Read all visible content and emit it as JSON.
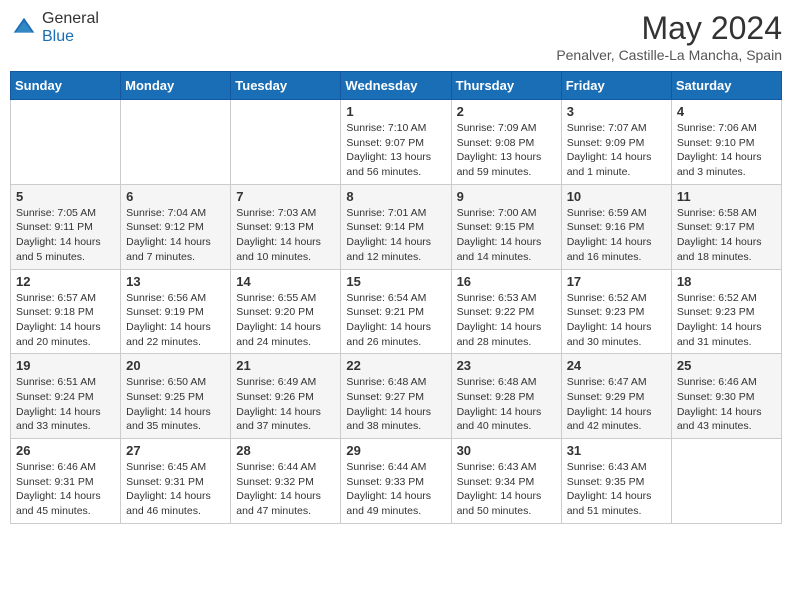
{
  "header": {
    "logo_general": "General",
    "logo_blue": "Blue",
    "month": "May 2024",
    "location": "Penalver, Castille-La Mancha, Spain"
  },
  "weekdays": [
    "Sunday",
    "Monday",
    "Tuesday",
    "Wednesday",
    "Thursday",
    "Friday",
    "Saturday"
  ],
  "weeks": [
    {
      "row_style": "odd",
      "days": [
        {
          "num": "",
          "info": ""
        },
        {
          "num": "",
          "info": ""
        },
        {
          "num": "",
          "info": ""
        },
        {
          "num": "1",
          "info": "Sunrise: 7:10 AM\nSunset: 9:07 PM\nDaylight: 13 hours\nand 56 minutes."
        },
        {
          "num": "2",
          "info": "Sunrise: 7:09 AM\nSunset: 9:08 PM\nDaylight: 13 hours\nand 59 minutes."
        },
        {
          "num": "3",
          "info": "Sunrise: 7:07 AM\nSunset: 9:09 PM\nDaylight: 14 hours\nand 1 minute."
        },
        {
          "num": "4",
          "info": "Sunrise: 7:06 AM\nSunset: 9:10 PM\nDaylight: 14 hours\nand 3 minutes."
        }
      ]
    },
    {
      "row_style": "even",
      "days": [
        {
          "num": "5",
          "info": "Sunrise: 7:05 AM\nSunset: 9:11 PM\nDaylight: 14 hours\nand 5 minutes."
        },
        {
          "num": "6",
          "info": "Sunrise: 7:04 AM\nSunset: 9:12 PM\nDaylight: 14 hours\nand 7 minutes."
        },
        {
          "num": "7",
          "info": "Sunrise: 7:03 AM\nSunset: 9:13 PM\nDaylight: 14 hours\nand 10 minutes."
        },
        {
          "num": "8",
          "info": "Sunrise: 7:01 AM\nSunset: 9:14 PM\nDaylight: 14 hours\nand 12 minutes."
        },
        {
          "num": "9",
          "info": "Sunrise: 7:00 AM\nSunset: 9:15 PM\nDaylight: 14 hours\nand 14 minutes."
        },
        {
          "num": "10",
          "info": "Sunrise: 6:59 AM\nSunset: 9:16 PM\nDaylight: 14 hours\nand 16 minutes."
        },
        {
          "num": "11",
          "info": "Sunrise: 6:58 AM\nSunset: 9:17 PM\nDaylight: 14 hours\nand 18 minutes."
        }
      ]
    },
    {
      "row_style": "odd",
      "days": [
        {
          "num": "12",
          "info": "Sunrise: 6:57 AM\nSunset: 9:18 PM\nDaylight: 14 hours\nand 20 minutes."
        },
        {
          "num": "13",
          "info": "Sunrise: 6:56 AM\nSunset: 9:19 PM\nDaylight: 14 hours\nand 22 minutes."
        },
        {
          "num": "14",
          "info": "Sunrise: 6:55 AM\nSunset: 9:20 PM\nDaylight: 14 hours\nand 24 minutes."
        },
        {
          "num": "15",
          "info": "Sunrise: 6:54 AM\nSunset: 9:21 PM\nDaylight: 14 hours\nand 26 minutes."
        },
        {
          "num": "16",
          "info": "Sunrise: 6:53 AM\nSunset: 9:22 PM\nDaylight: 14 hours\nand 28 minutes."
        },
        {
          "num": "17",
          "info": "Sunrise: 6:52 AM\nSunset: 9:23 PM\nDaylight: 14 hours\nand 30 minutes."
        },
        {
          "num": "18",
          "info": "Sunrise: 6:52 AM\nSunset: 9:23 PM\nDaylight: 14 hours\nand 31 minutes."
        }
      ]
    },
    {
      "row_style": "even",
      "days": [
        {
          "num": "19",
          "info": "Sunrise: 6:51 AM\nSunset: 9:24 PM\nDaylight: 14 hours\nand 33 minutes."
        },
        {
          "num": "20",
          "info": "Sunrise: 6:50 AM\nSunset: 9:25 PM\nDaylight: 14 hours\nand 35 minutes."
        },
        {
          "num": "21",
          "info": "Sunrise: 6:49 AM\nSunset: 9:26 PM\nDaylight: 14 hours\nand 37 minutes."
        },
        {
          "num": "22",
          "info": "Sunrise: 6:48 AM\nSunset: 9:27 PM\nDaylight: 14 hours\nand 38 minutes."
        },
        {
          "num": "23",
          "info": "Sunrise: 6:48 AM\nSunset: 9:28 PM\nDaylight: 14 hours\nand 40 minutes."
        },
        {
          "num": "24",
          "info": "Sunrise: 6:47 AM\nSunset: 9:29 PM\nDaylight: 14 hours\nand 42 minutes."
        },
        {
          "num": "25",
          "info": "Sunrise: 6:46 AM\nSunset: 9:30 PM\nDaylight: 14 hours\nand 43 minutes."
        }
      ]
    },
    {
      "row_style": "odd",
      "days": [
        {
          "num": "26",
          "info": "Sunrise: 6:46 AM\nSunset: 9:31 PM\nDaylight: 14 hours\nand 45 minutes."
        },
        {
          "num": "27",
          "info": "Sunrise: 6:45 AM\nSunset: 9:31 PM\nDaylight: 14 hours\nand 46 minutes."
        },
        {
          "num": "28",
          "info": "Sunrise: 6:44 AM\nSunset: 9:32 PM\nDaylight: 14 hours\nand 47 minutes."
        },
        {
          "num": "29",
          "info": "Sunrise: 6:44 AM\nSunset: 9:33 PM\nDaylight: 14 hours\nand 49 minutes."
        },
        {
          "num": "30",
          "info": "Sunrise: 6:43 AM\nSunset: 9:34 PM\nDaylight: 14 hours\nand 50 minutes."
        },
        {
          "num": "31",
          "info": "Sunrise: 6:43 AM\nSunset: 9:35 PM\nDaylight: 14 hours\nand 51 minutes."
        },
        {
          "num": "",
          "info": ""
        }
      ]
    }
  ]
}
